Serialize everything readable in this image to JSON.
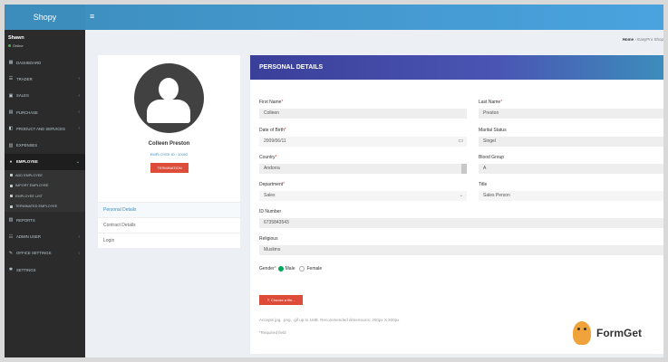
{
  "app": {
    "brand": "Shopy"
  },
  "user": {
    "name": "Shawn",
    "status": "Online"
  },
  "sidebar": {
    "items": [
      {
        "label": "Dashboard",
        "icon": "dashboard-icon",
        "chev": ""
      },
      {
        "label": "Trader",
        "icon": "users-icon",
        "chev": "‹"
      },
      {
        "label": "Sales",
        "icon": "cart-icon",
        "chev": "‹"
      },
      {
        "label": "Purchase",
        "icon": "basket-icon",
        "chev": "‹"
      },
      {
        "label": "Product and Services",
        "icon": "box-icon",
        "chev": "‹"
      },
      {
        "label": "Expenses",
        "icon": "money-icon",
        "chev": ""
      },
      {
        "label": "Employee",
        "icon": "employee-icon",
        "chev": "⌄"
      }
    ],
    "employee_sub": [
      "Add Employee",
      "Import Employee",
      "Employee List",
      "Terminated Employee"
    ],
    "items_after": [
      {
        "label": "Reports",
        "icon": "report-icon",
        "chev": ""
      },
      {
        "label": "Admin User",
        "icon": "admin-icon",
        "chev": "‹"
      },
      {
        "label": "Office Settings",
        "icon": "wrench-icon",
        "chev": "‹"
      },
      {
        "label": "Settings",
        "icon": "gear-icon",
        "chev": ""
      }
    ]
  },
  "breadcrumb": {
    "home": "Home",
    "current": "EasyPro Shop"
  },
  "profile": {
    "name": "Colleen Preston",
    "employee_id": "EMPLOYEE ID : 10002",
    "terminate_label": "TERMINATION",
    "tabs": [
      "Personal Details",
      "Contract Details",
      "Login"
    ]
  },
  "details": {
    "title": "PERSONAL DETAILS",
    "first_name_label": "First Name",
    "first_name": "Colleen",
    "last_name_label": "Last Name",
    "last_name": "Preston",
    "dob_label": "Date of Birth",
    "dob": "2009/06/11",
    "marital_label": "Marital Status",
    "marital": "Singel",
    "country_label": "Country",
    "country": "Andorra",
    "blood_label": "Blood Group",
    "blood": "A",
    "department_label": "Department",
    "department": "Sales",
    "title_label": "Title",
    "title_value": "Sales Person",
    "id_label": "ID Number",
    "id_value": "6735843543",
    "religious_label": "Religious",
    "religious": "Muslims",
    "gender_label": "Gender",
    "gender_male": "Male",
    "gender_female": "Female",
    "choose_file": "Choose a file...",
    "hint": "Accepts jpg, .png, .gif up to 1MB. Recommended dimensions: 200px X 200px",
    "required_note": "*Required field",
    "required_mark": "*"
  },
  "watermark": {
    "text": "FormGet"
  },
  "colors": {
    "topbar": "#3c8dbc",
    "sidebar": "#2b2b2b",
    "danger": "#dd4b39",
    "header_gradient": "#3a3f99"
  }
}
